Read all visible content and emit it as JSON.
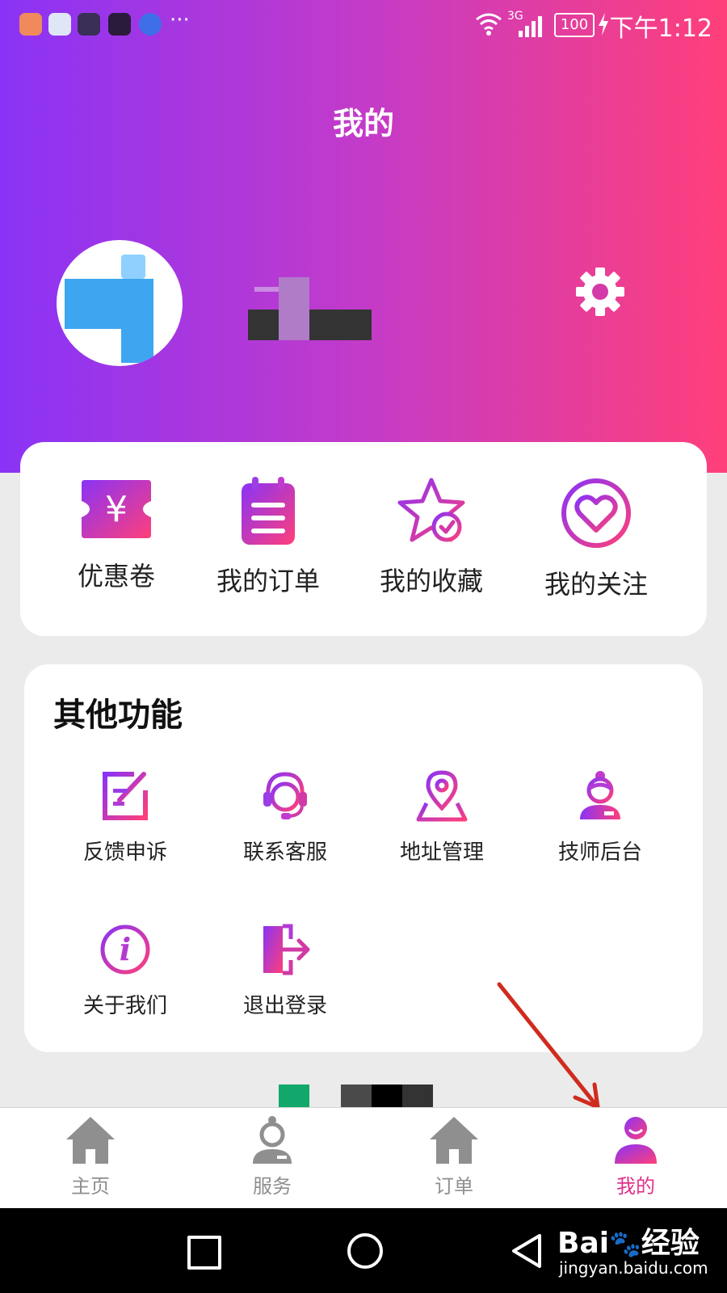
{
  "status_bar": {
    "network": "3G",
    "battery": "100",
    "time": "下午1:12"
  },
  "header": {
    "title": "我的"
  },
  "quick_actions": [
    {
      "label": "优惠卷",
      "icon": "coupon-icon"
    },
    {
      "label": "我的订单",
      "icon": "order-icon"
    },
    {
      "label": "我的收藏",
      "icon": "favorite-star-icon"
    },
    {
      "label": "我的关注",
      "icon": "heart-icon"
    }
  ],
  "other_functions": {
    "title": "其他功能",
    "items": [
      {
        "label": "反馈申诉",
        "icon": "feedback-icon"
      },
      {
        "label": "联系客服",
        "icon": "customer-service-icon"
      },
      {
        "label": "地址管理",
        "icon": "location-icon"
      },
      {
        "label": "技师后台",
        "icon": "technician-icon"
      },
      {
        "label": "关于我们",
        "icon": "info-icon"
      },
      {
        "label": "退出登录",
        "icon": "logout-icon"
      }
    ]
  },
  "tab_bar": [
    {
      "label": "主页",
      "icon": "home-icon",
      "active": false
    },
    {
      "label": "服务",
      "icon": "service-icon",
      "active": false
    },
    {
      "label": "订单",
      "icon": "order-home-icon",
      "active": false
    },
    {
      "label": "我的",
      "icon": "profile-icon",
      "active": true
    }
  ],
  "watermark": {
    "brand": "Bai",
    "suffix": "经验",
    "url": "jingyan.baidu.com"
  },
  "colors": {
    "gradient_start": "#8a33f6",
    "gradient_end": "#ff3f7a",
    "accent": "#e0318a",
    "tab_inactive": "#8f8f8f"
  }
}
